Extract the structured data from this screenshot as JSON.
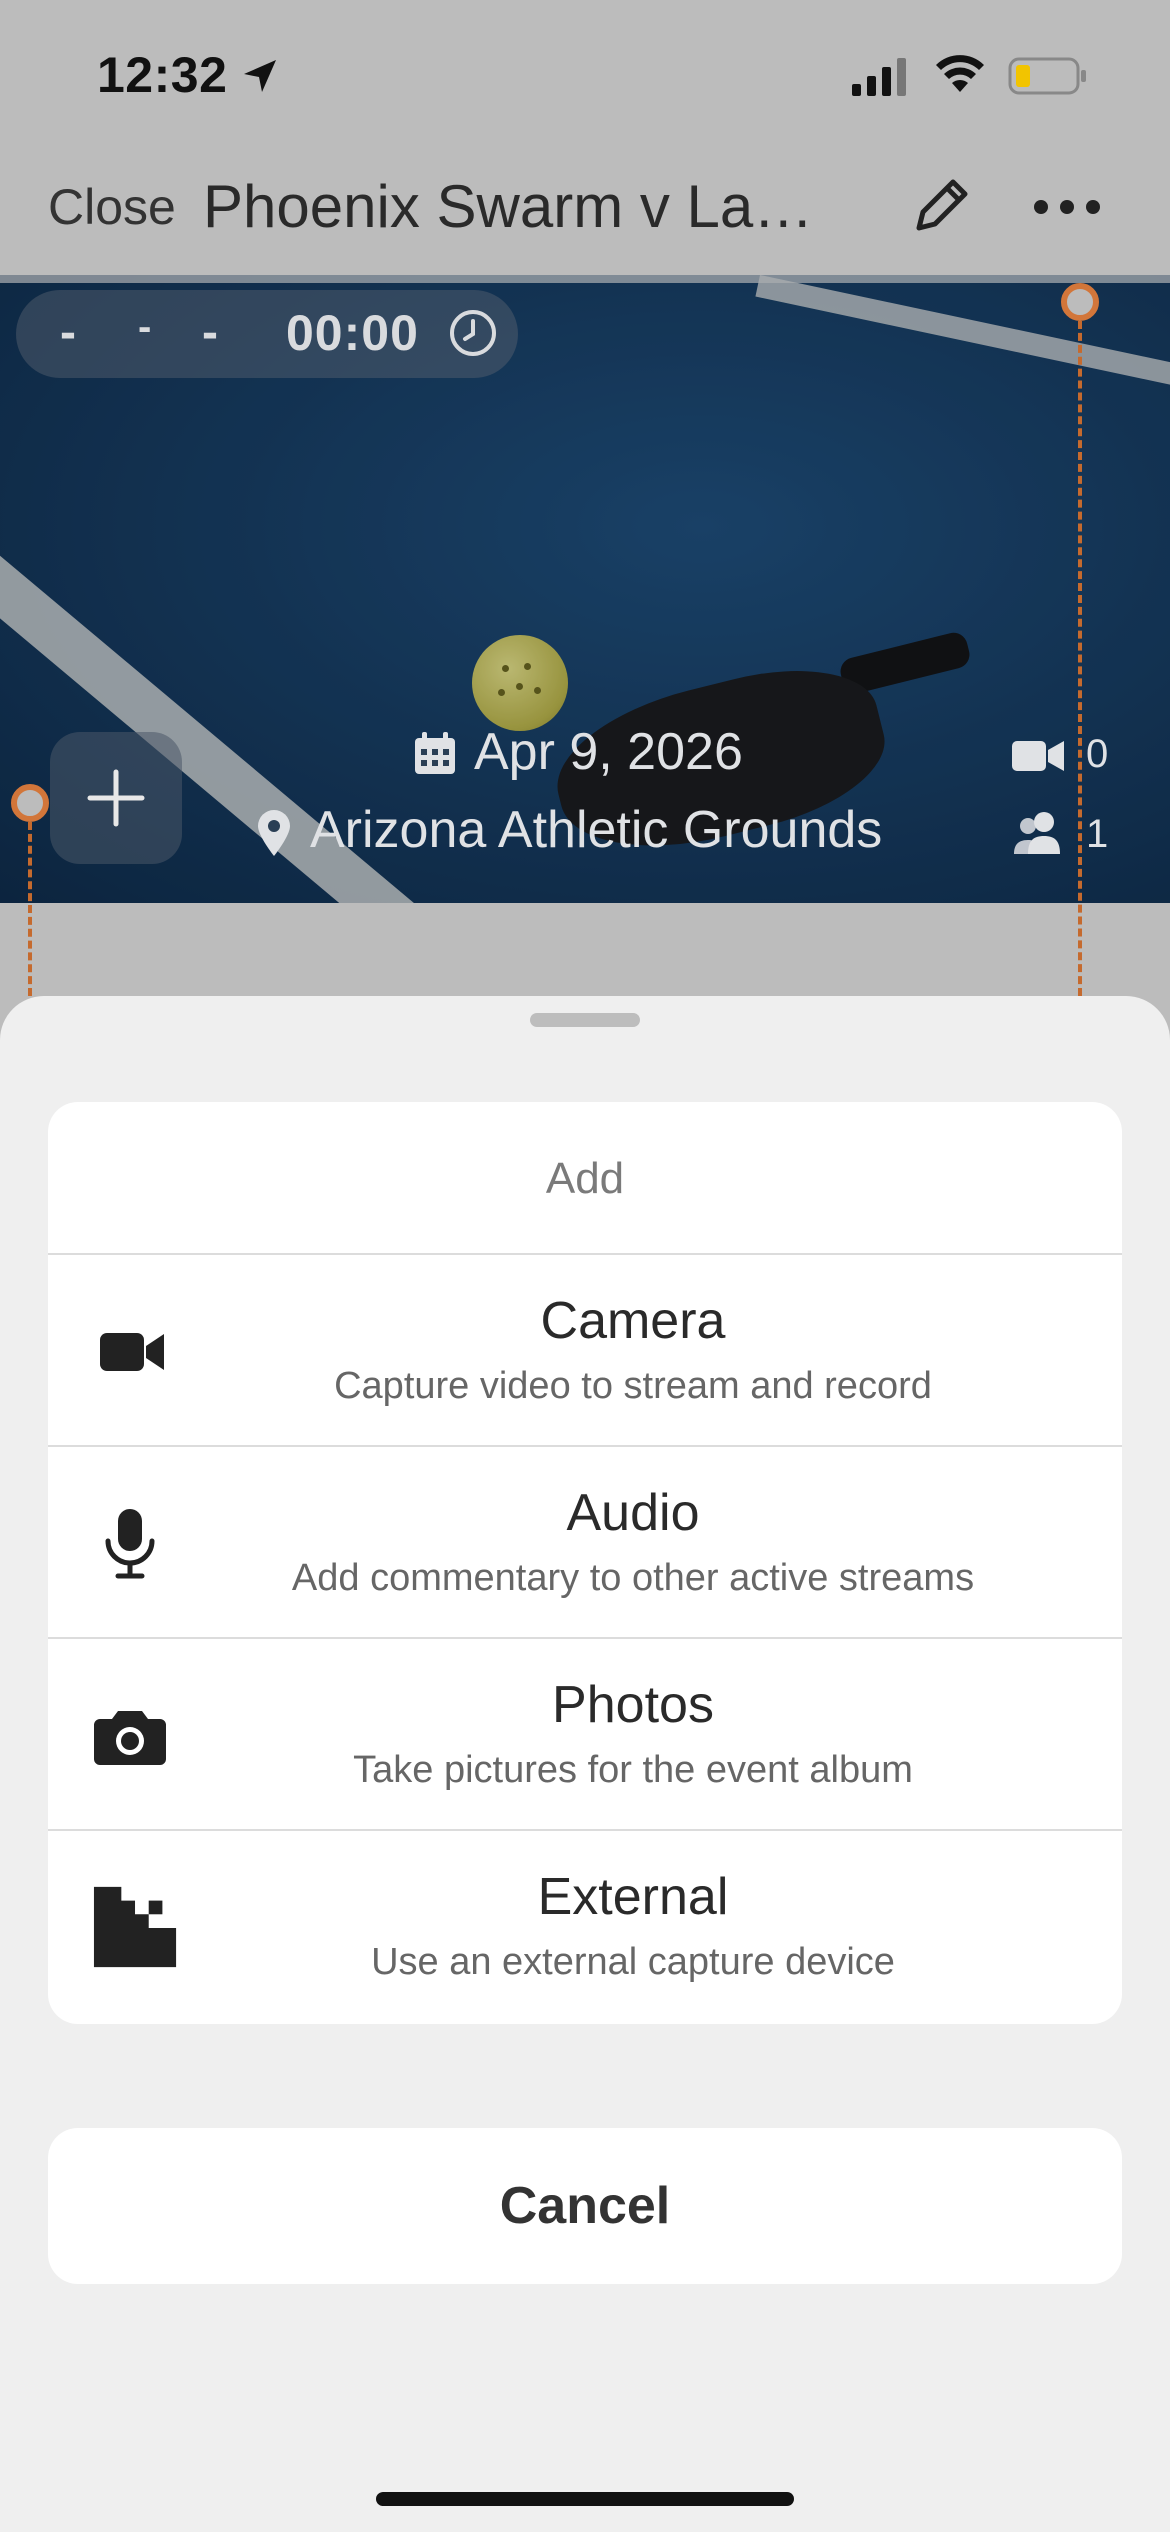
{
  "status_bar": {
    "time": "12:32"
  },
  "nav": {
    "close_label": "Close",
    "title": "Phoenix Swarm v Las Vegas"
  },
  "scoreboard": {
    "score_left": "-",
    "separator": "-",
    "score_right": "-",
    "timer": "00:00"
  },
  "event": {
    "date": "Apr 9, 2026",
    "venue": "Arizona Athletic Grounds",
    "video_count": "0",
    "participant_count": "1"
  },
  "add_sheet": {
    "heading": "Add",
    "options": [
      {
        "icon": "video-camera-icon",
        "title": "Camera",
        "subtitle": "Capture video to stream and record"
      },
      {
        "icon": "microphone-icon",
        "title": "Audio",
        "subtitle": "Add commentary to other active streams"
      },
      {
        "icon": "photo-camera-icon",
        "title": "Photos",
        "subtitle": "Take pictures for the event album"
      },
      {
        "icon": "external-device-icon",
        "title": "External",
        "subtitle": "Use an external capture device"
      }
    ],
    "cancel_label": "Cancel"
  },
  "colors": {
    "marker": "#d2763a",
    "sheet_bg": "#efefef",
    "dim_bg": "#bcbcbc"
  }
}
